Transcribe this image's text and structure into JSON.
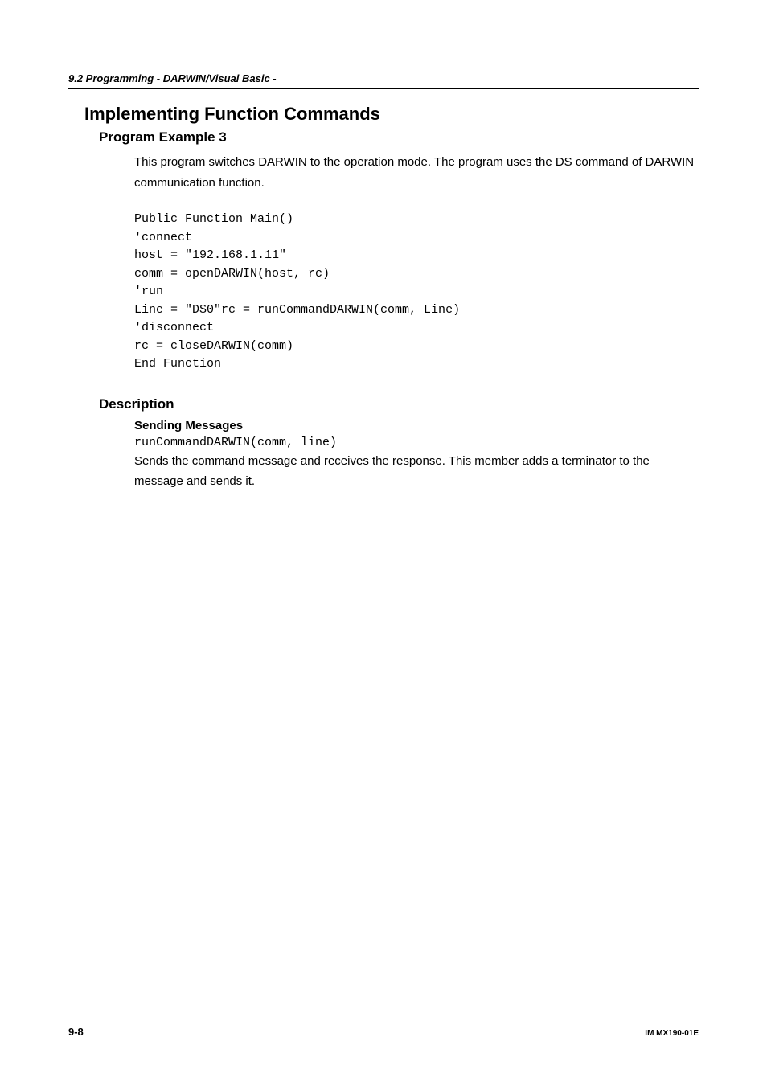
{
  "header": {
    "section_label": "9.2  Programming - DARWIN/Visual Basic -"
  },
  "main": {
    "heading": "Implementing Function Commands",
    "program_heading": "Program Example 3",
    "intro_text": "This program switches DARWIN to the operation mode. The program uses the DS command of DARWIN communication function.",
    "code": "Public Function Main()\n'connect\nhost = \"192.168.1.11\"\ncomm = openDARWIN(host, rc)\n'run\nLine = \"DS0\"rc = runCommandDARWIN(comm, Line)\n'disconnect\nrc = closeDARWIN(comm)\nEnd Function",
    "description_heading": "Description",
    "sending_heading": "Sending Messages",
    "sending_code": "runCommandDARWIN(comm, line)",
    "sending_text": "Sends the command message and receives the response. This member adds a terminator to the message and sends it."
  },
  "footer": {
    "page_number": "9-8",
    "doc_id": "IM MX190-01E"
  }
}
